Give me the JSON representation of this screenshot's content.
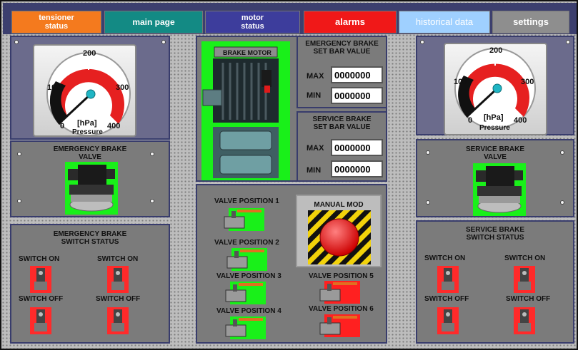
{
  "tabs": [
    {
      "label": "tensioner\nstatus",
      "bg": "#f47a1e"
    },
    {
      "label": "main page",
      "bg": "#138a84"
    },
    {
      "label": "motor\nstatus",
      "bg": "#3d3d9c"
    },
    {
      "label": "alarms",
      "bg": "#f01818"
    },
    {
      "label": "historical data",
      "bg": "#9fd0ff"
    },
    {
      "label": "settings",
      "bg": "#8e8e8e"
    }
  ],
  "left": {
    "gauge": {
      "ticks": [
        "0",
        "100",
        "200",
        "300",
        "400"
      ],
      "unit": "[hPa]",
      "name": "Pressure",
      "value": 0
    },
    "valve_title": "EMERGENCY BRAKE\nVALVE",
    "switch_title": "EMERGENCY BRAKE\nSWITCH STATUS",
    "switch_labels": [
      "SWITCH ON",
      "SWITCH ON",
      "SWITCH OFF",
      "SWITCH OFF"
    ]
  },
  "right": {
    "gauge": {
      "ticks": [
        "0",
        "100",
        "200",
        "300",
        "400"
      ],
      "unit": "[hPa]",
      "name": "Pressure",
      "value": 0
    },
    "valve_title": "SERVICE BRAKE\nVALVE",
    "switch_title": "SERVICE BRAKE\nSWITCH STATUS",
    "switch_labels": [
      "SWITCH ON",
      "SWITCH ON",
      "SWITCH OFF",
      "SWITCH OFF"
    ]
  },
  "motor": {
    "title": "BRAKE MOTOR"
  },
  "emergency_set": {
    "title": "EMERGENCY BRAKE\nSET BAR VALUE",
    "max_label": "MAX",
    "min_label": "MIN",
    "max_value": "0000000",
    "min_value": "0000000"
  },
  "service_set": {
    "title": "SERVICE BRAKE\nSET BAR VALUE",
    "max_label": "MAX",
    "min_label": "MIN",
    "max_value": "0000000",
    "min_value": "0000000"
  },
  "valves": {
    "p1": "VALVE POSITION 1",
    "p2": "VALVE POSITION 2",
    "p3": "VALVE POSITION 3",
    "p4": "VALVE POSITION 4",
    "p5": "VALVE POSITION 5",
    "p6": "VALVE POSITION 6"
  },
  "manual_mode": {
    "label": "MANUAL MOD"
  },
  "colors": {
    "active": "#19f019",
    "inactive": "#ff2020",
    "panel": "#7b7b7b",
    "border": "#383c6c"
  }
}
